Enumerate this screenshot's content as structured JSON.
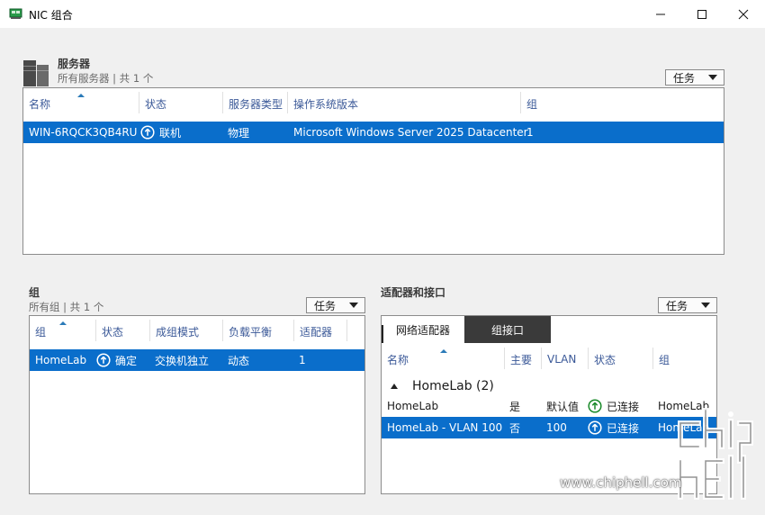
{
  "window": {
    "title": "NIC 组合",
    "minimize_label": "minimize",
    "maximize_label": "maximize",
    "close_label": "close"
  },
  "servers": {
    "title": "服务器",
    "subtitle": "所有服务器 | 共 1 个",
    "tasks_label": "任务",
    "columns": [
      "名称",
      "状态",
      "服务器类型",
      "操作系统版本",
      "组"
    ],
    "rows": [
      {
        "name": "WIN-6RQCK3QB4RU",
        "status": "联机",
        "type": "物理",
        "os": "Microsoft Windows Server 2025 Datacenter",
        "groups": "1"
      }
    ]
  },
  "teams": {
    "title": "组",
    "subtitle": "所有组 | 共 1 个",
    "tasks_label": "任务",
    "columns": [
      "组",
      "状态",
      "成组模式",
      "负载平衡",
      "适配器"
    ],
    "rows": [
      {
        "name": "HomeLab",
        "status": "确定",
        "mode": "交换机独立",
        "lb": "动态",
        "adapters": "1"
      }
    ]
  },
  "adapters": {
    "title": "适配器和接口",
    "tasks_label": "任务",
    "tabs": [
      "网络适配器",
      "组接口"
    ],
    "active_tab": "组接口",
    "columns": [
      "名称",
      "主要",
      "VLAN",
      "状态",
      "组"
    ],
    "group_header": "HomeLab (2)",
    "rows": [
      {
        "name": "HomeLab",
        "primary": "是",
        "vlan": "默认值",
        "status": "已连接",
        "team": "HomeLab",
        "selected": false
      },
      {
        "name": "HomeLab - VLAN 100",
        "primary": "否",
        "vlan": "100",
        "status": "已连接",
        "team": "HomeLab",
        "selected": true
      }
    ]
  },
  "watermark": {
    "url": "www.chiphell.com",
    "logo_text": "chip hell"
  },
  "colors": {
    "selection": "#0a6ecb",
    "header_text": "#3b5998",
    "status_ok": "#1a8a2a",
    "background": "#f0f0f0"
  },
  "icons": {
    "app": "nic-team-icon",
    "servers": "server-stack-icon",
    "status": "up-arrow-circle-icon"
  }
}
